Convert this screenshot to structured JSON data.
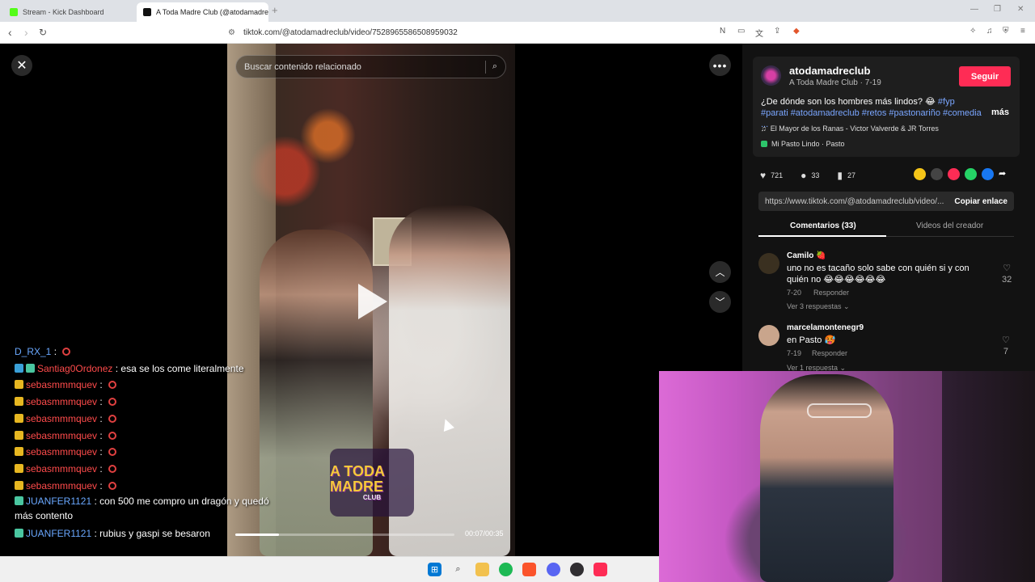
{
  "browser": {
    "tabs": [
      {
        "title": "Stream - Kick Dashboard",
        "favicon_color": "#53fc18"
      },
      {
        "title": "A Toda Madre Club (@atodamadreclub",
        "favicon_color": "#111111"
      }
    ],
    "url": "tiktok.com/@atodamadreclub/video/7528965586508959032"
  },
  "video": {
    "search_placeholder": "Buscar contenido relacionado",
    "timecode": "00:07/00:35",
    "progress": 0.2,
    "logo_text": "A TODA MADRE",
    "logo_sub": "CLUB"
  },
  "chat": [
    {
      "user": "D_RX_1",
      "color": "#6aa8ff",
      "badges": [],
      "msg": ""
    },
    {
      "user": "Santiag0Ordonez",
      "color": "#ff4b4b",
      "badges": [
        "blue",
        "green"
      ],
      "msg": "esa se los come literalmente"
    },
    {
      "user": "sebasmmmquev",
      "color": "#ff4b4b",
      "badges": [
        "crown"
      ],
      "msg": ""
    },
    {
      "user": "sebasmmmquev",
      "color": "#ff4b4b",
      "badges": [
        "crown"
      ],
      "msg": ""
    },
    {
      "user": "sebasmmmquev",
      "color": "#ff4b4b",
      "badges": [
        "crown"
      ],
      "msg": ""
    },
    {
      "user": "sebasmmmquev",
      "color": "#ff4b4b",
      "badges": [
        "crown"
      ],
      "msg": ""
    },
    {
      "user": "sebasmmmquev",
      "color": "#ff4b4b",
      "badges": [
        "crown"
      ],
      "msg": ""
    },
    {
      "user": "sebasmmmquev",
      "color": "#ff4b4b",
      "badges": [
        "crown"
      ],
      "msg": ""
    },
    {
      "user": "sebasmmmquev",
      "color": "#ff4b4b",
      "badges": [
        "crown"
      ],
      "msg": ""
    },
    {
      "user": "JUANFER1121",
      "color": "#6aa8ff",
      "badges": [
        "green"
      ],
      "msg": "con 500 me compro un dragón y quedó más contento"
    },
    {
      "user": "JUANFER1121",
      "color": "#6aa8ff",
      "badges": [
        "green"
      ],
      "msg": "rubius y gaspi se besaron"
    }
  ],
  "post": {
    "author": "atodamadreclub",
    "author_sub": "A Toda Madre Club · 7-19",
    "follow_label": "Seguir",
    "caption_text": "¿De dónde son los hombres más lindos? 😂 ",
    "caption_tags": "#fyp #parati #atodamadreclub #retos #pastonariño #comedia ...",
    "more_label": "más",
    "music": "El Mayor de los Ranas - Victor Valverde & JR Torres",
    "location": "Mi Pasto Lindo · Pasto",
    "likes": "721",
    "comments": "33",
    "saves": "27",
    "link": "https://www.tiktok.com/@atodamadreclub/video/...",
    "copy_label": "Copiar enlace",
    "tab_comments": "Comentarios (33)",
    "tab_creator": "Videos del creador"
  },
  "comments": [
    {
      "user": "Camilo 🍓",
      "text": "uno no es tacaño solo sabe con quién si y con quién no 😂😂😂😂😂😂",
      "date": "7-20",
      "reply_label": "Responder",
      "replies": "Ver 3 respuestas ⌄",
      "likes": "32"
    },
    {
      "user": "marcelamontenegr9",
      "text": "en Pasto 🥵",
      "date": "7-19",
      "reply_label": "Responder",
      "replies": "Ver 1 respuesta ⌄",
      "likes": "7"
    }
  ],
  "colors": {
    "accent": "#fe2c55",
    "hashtag": "#7aa6ff"
  }
}
